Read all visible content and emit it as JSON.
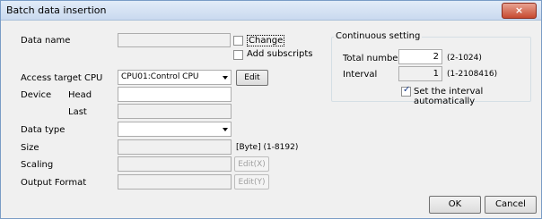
{
  "window": {
    "title": "Batch data insertion",
    "close_label": "×"
  },
  "data_name": {
    "label": "Data name",
    "value": "",
    "change_label": "Change",
    "add_subscripts_label": "Add subscripts"
  },
  "access_target_cpu": {
    "label": "Access target CPU",
    "value": "CPU01:Control CPU",
    "edit_label": "Edit"
  },
  "device": {
    "label": "Device",
    "head_label": "Head",
    "head_value": "",
    "last_label": "Last",
    "last_value": ""
  },
  "data_type": {
    "label": "Data type",
    "value": ""
  },
  "size": {
    "label": "Size",
    "value": "",
    "unit_range": "[Byte] (1-8192)"
  },
  "scaling": {
    "label": "Scaling",
    "value": "",
    "edit_label": "Edit(X)"
  },
  "output_format": {
    "label": "Output Format",
    "value": "",
    "edit_label": "Edit(Y)"
  },
  "continuous": {
    "group_label": "Continuous setting",
    "total_label": "Total number",
    "total_value": "2",
    "total_range": "(2-1024)",
    "interval_label": "Interval",
    "interval_value": "1",
    "interval_range": "(1-2108416)",
    "auto_label": "Set the interval automatically",
    "auto_checked": true
  },
  "footer": {
    "ok_label": "OK",
    "cancel_label": "Cancel"
  }
}
